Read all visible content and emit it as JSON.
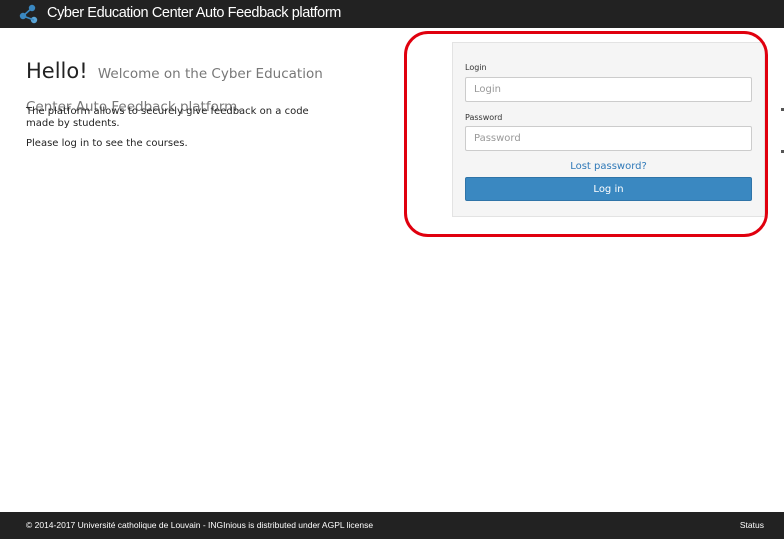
{
  "navbar": {
    "title": "Cyber Education Center Auto Feedback platform",
    "logo_icon": "inginious-logo-icon",
    "accent_color": "#3a88c1"
  },
  "intro": {
    "hello": "Hello!",
    "welcome": "Welcome on the Cyber Education Center Auto Feedback platform.",
    "description": "The platform allows to securely give feedback on a code made by students.",
    "login_prompt": "Please log in to see the courses."
  },
  "login_form": {
    "login_label": "Login",
    "login_placeholder": "Login",
    "login_value": "",
    "password_label": "Password",
    "password_placeholder": "Password",
    "password_value": "",
    "lost_password": "Lost password?",
    "submit_label": "Log in",
    "highlight_color": "#e0000e"
  },
  "footer": {
    "copyright": "© 2014-2017 Université catholique de Louvain - INGInious is distributed under AGPL license",
    "status": "Status"
  }
}
